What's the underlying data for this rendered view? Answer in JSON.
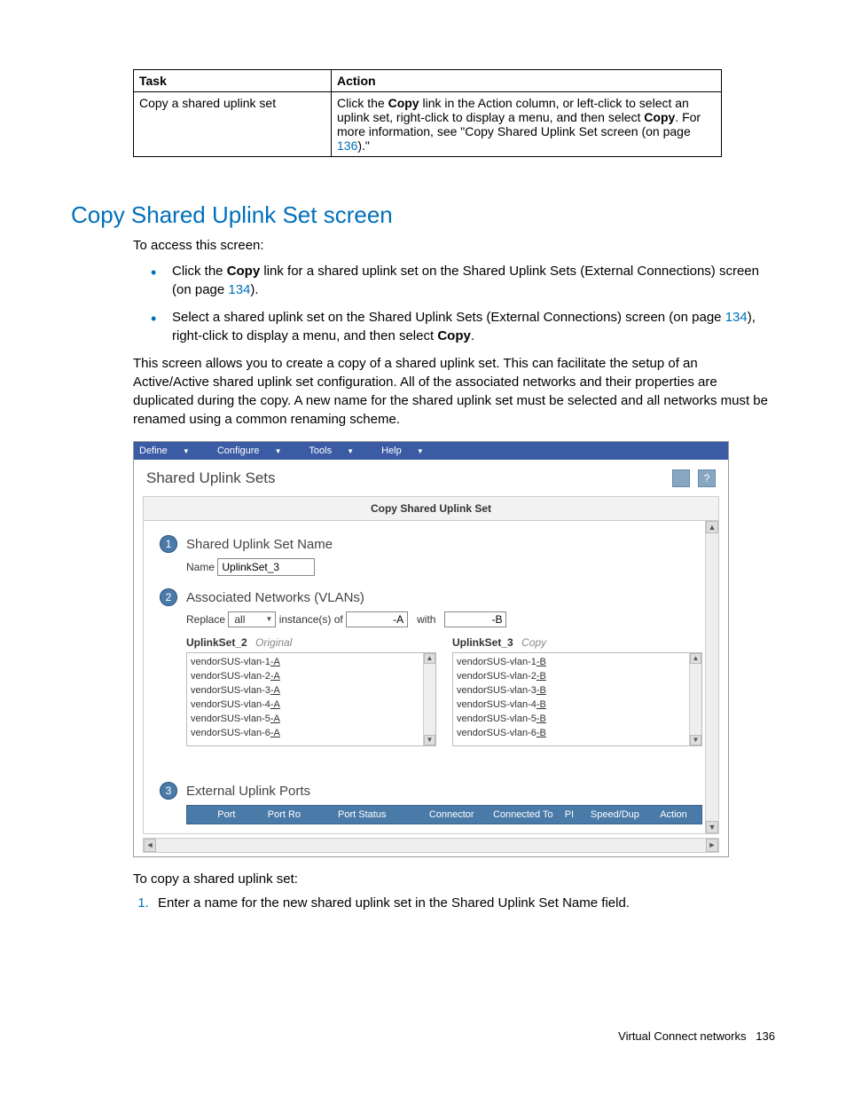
{
  "table": {
    "headers": {
      "task": "Task",
      "action": "Action"
    },
    "row": {
      "task": "Copy a shared uplink set",
      "action_pre": "Click the ",
      "action_b1": "Copy",
      "action_mid": " link in the Action column, or left-click to select an uplink set, right-click to display a menu, and then select ",
      "action_b2": "Copy",
      "action_post1": ". For more information, see \"Copy Shared Uplink Set screen (on page ",
      "action_link": "136",
      "action_post2": ").\""
    }
  },
  "heading": "Copy Shared Uplink Set screen",
  "intro": "To access this screen:",
  "bullets": {
    "b1_pre": "Click the ",
    "b1_bold": "Copy",
    "b1_mid": " link for a shared uplink set on the Shared Uplink Sets (External Connections) screen (on page ",
    "b1_link": "134",
    "b1_post": ").",
    "b2_pre": "Select a shared uplink set on the Shared Uplink Sets (External Connections) screen (on page ",
    "b2_link": "134",
    "b2_mid": "), right-click to display a menu, and then select ",
    "b2_bold": "Copy",
    "b2_post": "."
  },
  "para": "This screen allows you to create a copy of a shared uplink set. This can facilitate the setup of an Active/Active shared uplink set configuration. All of the associated networks and their properties are duplicated during the copy. A new name for the shared uplink set must be selected and all networks must be renamed using a common renaming scheme.",
  "shot": {
    "menus": {
      "define": "Define",
      "configure": "Configure",
      "tools": "Tools",
      "help": "Help"
    },
    "title": "Shared Uplink Sets",
    "helpicon": "?",
    "panel_head": "Copy Shared Uplink Set",
    "step1": {
      "num": "1",
      "label": "Shared Uplink Set Name",
      "name_label": "Name",
      "name_value": "UplinkSet_3"
    },
    "step2": {
      "num": "2",
      "label": "Associated Networks (VLANs)",
      "replace": "Replace",
      "all": "all",
      "instances": "instance(s) of",
      "suffix_a": "-A",
      "with": "with",
      "suffix_b": "-B",
      "orig_head": "UplinkSet_2",
      "orig_tag": "Original",
      "copy_head": "UplinkSet_3",
      "copy_tag": "Copy",
      "orig_items_prefix": "vendorSUS-vlan-",
      "copy_items_prefix": "vendorSUS-vlan-",
      "orig_suffix": "-A",
      "copy_suffix": "-B",
      "count": [
        "1",
        "2",
        "3",
        "4",
        "5",
        "6"
      ]
    },
    "step3": {
      "num": "3",
      "label": "External Uplink Ports",
      "cols": {
        "port": "Port",
        "role": "Port Ro",
        "status": "Port Status",
        "connector": "Connector",
        "connto": "Connected To",
        "pi": "PI",
        "speed": "Speed/Dup",
        "action": "Action"
      }
    }
  },
  "after_shot": "To copy a shared uplink set:",
  "ol_item": "Enter a name for the new shared uplink set in the Shared Uplink Set Name field.",
  "footer": {
    "text": "Virtual Connect networks",
    "page": "136"
  }
}
